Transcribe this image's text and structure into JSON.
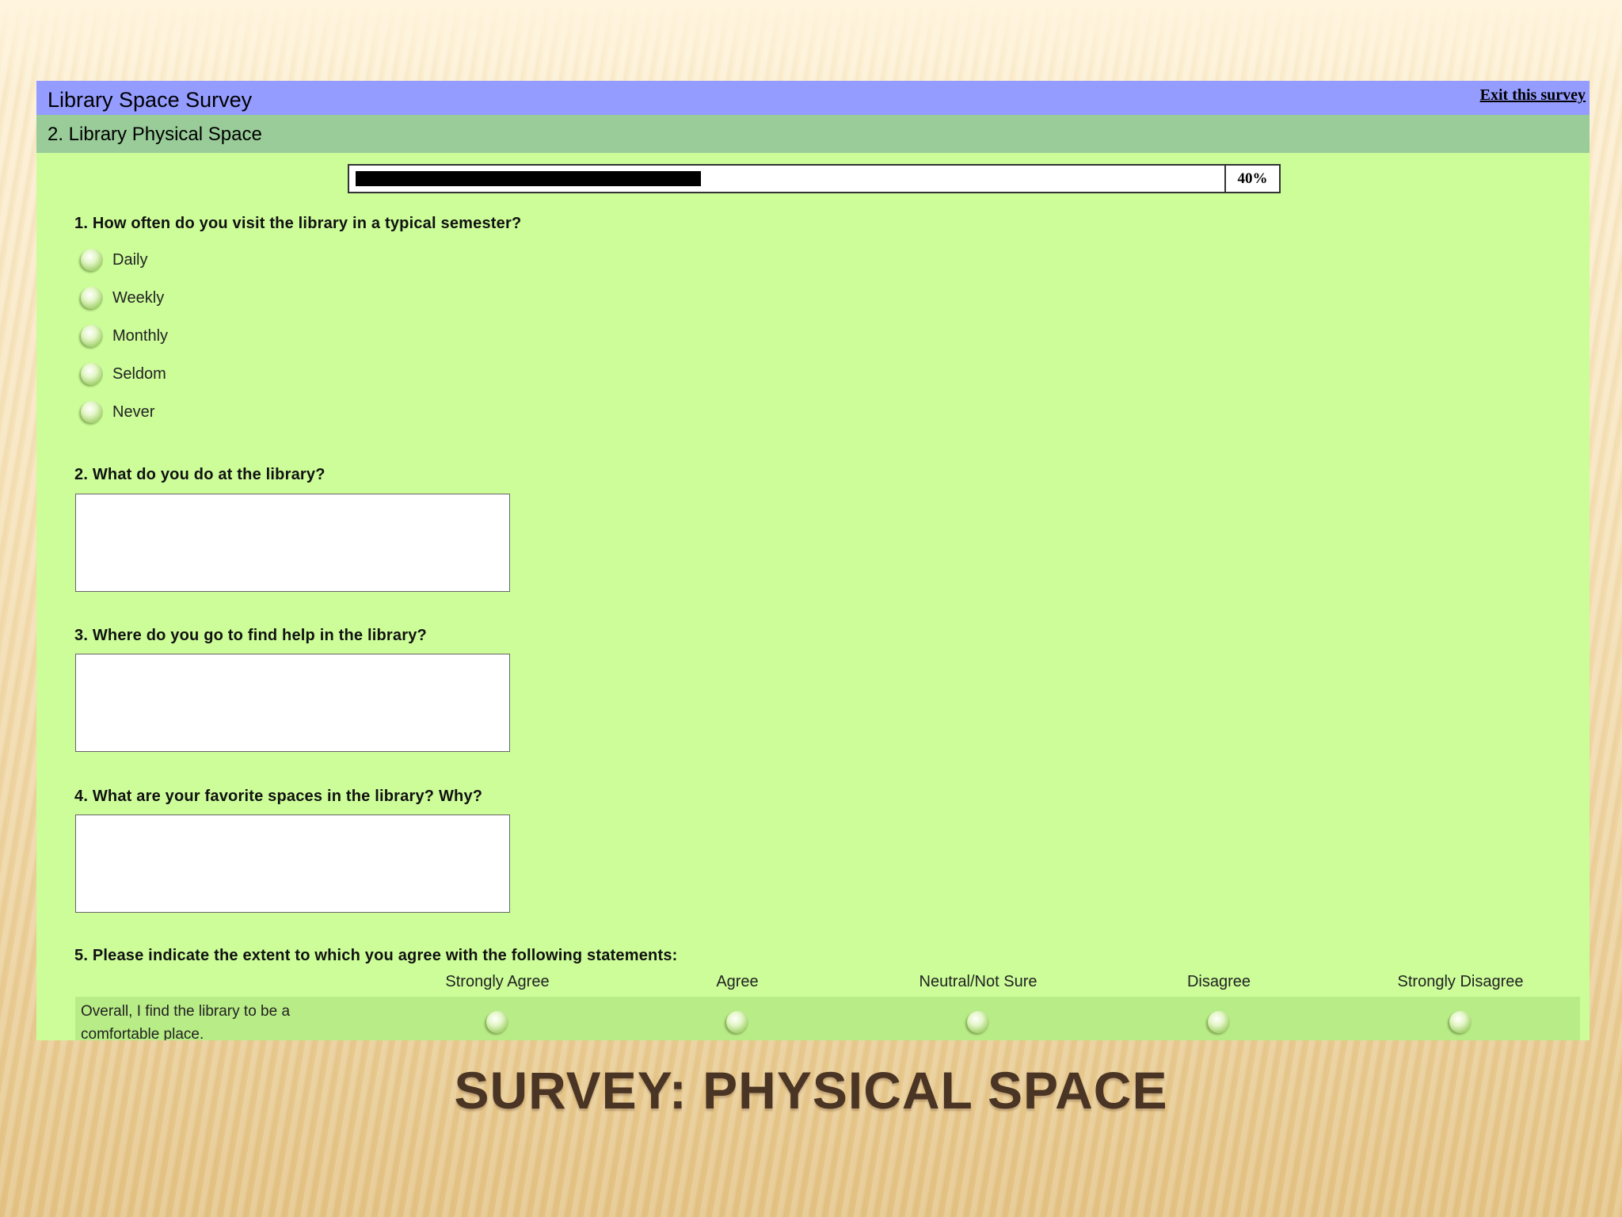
{
  "survey": {
    "title": "Library Space Survey",
    "exit_label": "Exit this survey",
    "section_title": "2. Library Physical Space",
    "progress": {
      "percent": 40,
      "label": "40%"
    }
  },
  "questions": {
    "q1": {
      "text": "1. How often do you visit the library in a typical semester?",
      "options": [
        "Daily",
        "Weekly",
        "Monthly",
        "Seldom",
        "Never"
      ]
    },
    "q2": {
      "text": "2. What do you do at the library?",
      "value": ""
    },
    "q3": {
      "text": "3. Where do you go to find help in the library?",
      "value": ""
    },
    "q4": {
      "text": "4. What are your favorite spaces in the library? Why?",
      "value": ""
    },
    "q5": {
      "text": "5. Please indicate the extent to which you agree with the following statements:",
      "columns": [
        "Strongly Agree",
        "Agree",
        "Neutral/Not Sure",
        "Disagree",
        "Strongly Disagree"
      ],
      "rows": [
        "Overall, I find the library to be a comfortable place."
      ]
    }
  },
  "slide": {
    "title": "SURVEY: PHYSICAL SPACE"
  },
  "colors": {
    "header": "#949cff",
    "section": "#99cc99",
    "panel": "#ccfd99",
    "matrix_row": "#b8ec86",
    "title_text": "#4a3424"
  }
}
